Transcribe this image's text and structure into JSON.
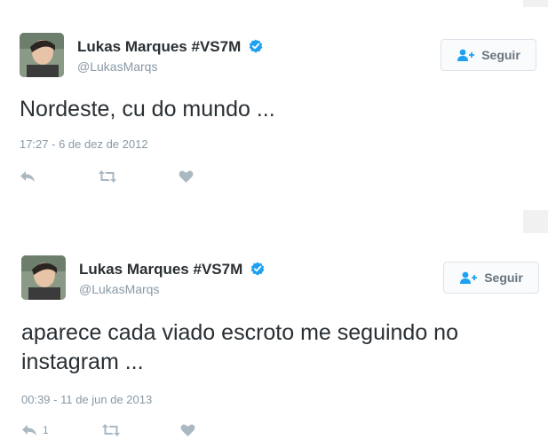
{
  "tweets": [
    {
      "name": "Lukas Marques #VS7M",
      "handle": "@LukasMarqs",
      "follow_label": "Seguir",
      "text": "Nordeste, cu do mundo ...",
      "timestamp": "17:27 - 6 de dez de 2012",
      "reply_count": "",
      "retweet_count": "",
      "like_count": ""
    },
    {
      "name": "Lukas Marques #VS7M",
      "handle": "@LukasMarqs",
      "follow_label": "Seguir",
      "text": "aparece cada viado escroto me seguindo no instagram ...",
      "timestamp": "00:39 - 11 de jun de 2013",
      "reply_count": "1",
      "retweet_count": "",
      "like_count": ""
    }
  ],
  "colors": {
    "verified": "#1da1f2",
    "muted": "#8899a6",
    "icon": "#aab8c2",
    "text": "#292f33"
  },
  "icons": [
    "verified-badge-icon",
    "add-user-icon",
    "reply-icon",
    "retweet-icon",
    "like-icon"
  ]
}
